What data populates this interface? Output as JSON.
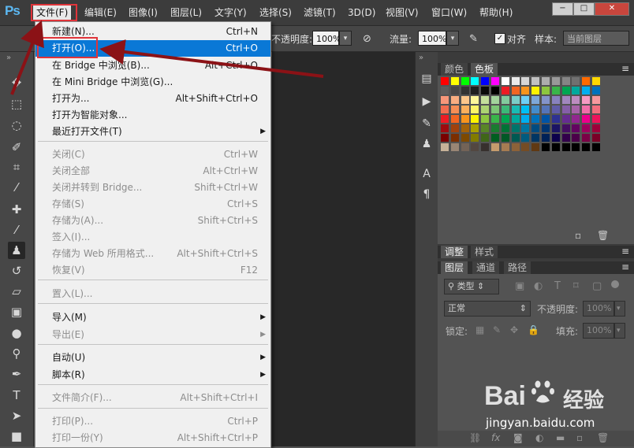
{
  "app": {
    "logo_text": "Ps"
  },
  "menubar": {
    "items": [
      "文件(F)",
      "编辑(E)",
      "图像(I)",
      "图层(L)",
      "文字(Y)",
      "选择(S)",
      "滤镜(T)",
      "3D(D)",
      "视图(V)",
      "窗口(W)",
      "帮助(H)"
    ],
    "active_index": 0
  },
  "window_controls": {
    "minimize": "−",
    "maximize": "□",
    "close": "✕"
  },
  "optionsbar": {
    "opacity_label": "不透明度:",
    "opacity_value": "100%",
    "flow_label": "流量:",
    "flow_value": "100%",
    "align_label": "对齐",
    "align_checked": "✓",
    "sample_label": "样本:",
    "sample_value": "当前图层",
    "dropdown_glyph": "▾"
  },
  "file_menu": {
    "items": [
      {
        "label": "新建(N)...",
        "shortcut": "Ctrl+N",
        "disabled": false
      },
      {
        "label": "打开(O)...",
        "shortcut": "Ctrl+O",
        "disabled": false,
        "highlighted": true
      },
      {
        "label": "在 Bridge 中浏览(B)...",
        "shortcut": "Alt+Ctrl+O",
        "disabled": false
      },
      {
        "label": "在 Mini Bridge 中浏览(G)...",
        "shortcut": "",
        "disabled": false
      },
      {
        "label": "打开为...",
        "shortcut": "Alt+Shift+Ctrl+O",
        "disabled": false
      },
      {
        "label": "打开为智能对象...",
        "shortcut": "",
        "disabled": false
      },
      {
        "label": "最近打开文件(T)",
        "shortcut": "",
        "disabled": false,
        "submenu": true
      },
      {
        "label": "关闭(C)",
        "shortcut": "Ctrl+W",
        "disabled": true
      },
      {
        "label": "关闭全部",
        "shortcut": "Alt+Ctrl+W",
        "disabled": true
      },
      {
        "label": "关闭并转到 Bridge...",
        "shortcut": "Shift+Ctrl+W",
        "disabled": true
      },
      {
        "label": "存储(S)",
        "shortcut": "Ctrl+S",
        "disabled": true
      },
      {
        "label": "存储为(A)...",
        "shortcut": "Shift+Ctrl+S",
        "disabled": true
      },
      {
        "label": "签入(I)...",
        "shortcut": "",
        "disabled": true
      },
      {
        "label": "存储为 Web 所用格式...",
        "shortcut": "Alt+Shift+Ctrl+S",
        "disabled": true
      },
      {
        "label": "恢复(V)",
        "shortcut": "F12",
        "disabled": true
      },
      {
        "label": "置入(L)...",
        "shortcut": "",
        "disabled": true
      },
      {
        "label": "导入(M)",
        "shortcut": "",
        "disabled": false,
        "submenu": true
      },
      {
        "label": "导出(E)",
        "shortcut": "",
        "disabled": true,
        "submenu": true
      },
      {
        "label": "自动(U)",
        "shortcut": "",
        "disabled": false,
        "submenu": true
      },
      {
        "label": "脚本(R)",
        "shortcut": "",
        "disabled": false,
        "submenu": true
      },
      {
        "label": "文件简介(F)...",
        "shortcut": "Alt+Shift+Ctrl+I",
        "disabled": true
      },
      {
        "label": "打印(P)...",
        "shortcut": "Ctrl+P",
        "disabled": true
      },
      {
        "label": "打印一份(Y)",
        "shortcut": "Alt+Shift+Ctrl+P",
        "disabled": true
      }
    ],
    "submenu_glyph": "▶"
  },
  "panels": {
    "swatches_tabs": [
      "颜色",
      "色板"
    ],
    "swatches_active": 1,
    "adjust_tabs": [
      "调整",
      "样式"
    ],
    "layers_tabs": [
      "图层",
      "通道",
      "路径"
    ],
    "filter_label": "类型",
    "blend_mode": "正常",
    "opacity_label": "不透明度:",
    "opacity_value": "100%",
    "lock_label": "锁定:",
    "fill_label": "填充:",
    "fill_value": "100%",
    "menu_glyph": "≡",
    "collapse_glyph": "»"
  },
  "swatches": {
    "rows": [
      [
        "#ff0000",
        "#ffff00",
        "#00ff00",
        "#00ffff",
        "#0000ff",
        "#ff00ff",
        "#ffffff",
        "#ebebeb",
        "#d6d6d6",
        "#c2c2c2",
        "#adadad",
        "#999999",
        "#858585",
        "#707070",
        "#ff6a00",
        "#ffd800"
      ],
      [
        "#5c5c5c",
        "#474747",
        "#333333",
        "#1f1f1f",
        "#0a0a0a",
        "#000000",
        "#ed1c24",
        "#f26522",
        "#f7941d",
        "#fff200",
        "#8dc63f",
        "#39b54a",
        "#00a651",
        "#00a99d",
        "#00aeef",
        "#0072bc"
      ],
      [
        "#f7977a",
        "#f9ad81",
        "#fdc68a",
        "#fff79a",
        "#c4df9b",
        "#a2d39c",
        "#82ca9d",
        "#7bcdc8",
        "#6ecff6",
        "#7ea7d8",
        "#8493ca",
        "#8882be",
        "#a187be",
        "#bc8cbf",
        "#f49ac2",
        "#f6989d"
      ],
      [
        "#f26c4f",
        "#f68e55",
        "#fbaf5c",
        "#fff467",
        "#acd372",
        "#7cc576",
        "#3bb878",
        "#1abbb4",
        "#00bff3",
        "#438ccb",
        "#5574b9",
        "#605ca8",
        "#855fa8",
        "#a763a8",
        "#f06ea9",
        "#f26d7d"
      ],
      [
        "#ed1c24",
        "#f26522",
        "#f7941d",
        "#fff200",
        "#8dc63f",
        "#39b54a",
        "#00a651",
        "#00a99d",
        "#00aeef",
        "#0072bc",
        "#0054a6",
        "#2e3192",
        "#662d91",
        "#92278f",
        "#ec008c",
        "#ed145b"
      ],
      [
        "#9e0b0f",
        "#a0410d",
        "#a36209",
        "#aba000",
        "#598527",
        "#1a7b30",
        "#007236",
        "#00746b",
        "#0076a3",
        "#004b80",
        "#003471",
        "#1b1464",
        "#440e62",
        "#630460",
        "#9e005d",
        "#9e0039"
      ],
      [
        "#790000",
        "#7b2e00",
        "#7d4900",
        "#827b00",
        "#406618",
        "#005e20",
        "#005826",
        "#005952",
        "#005b7f",
        "#003663",
        "#002157",
        "#0d004c",
        "#32004b",
        "#4b0049",
        "#7b0046",
        "#7a0026"
      ],
      [
        "#c7b299",
        "#998675",
        "#736357",
        "#534741",
        "#37302d",
        "#c69c6d",
        "#a67c52",
        "#8c6239",
        "#754c24",
        "#603913",
        "#000000",
        "#000000",
        "#000000",
        "#000000",
        "#000000",
        "#000000"
      ]
    ]
  },
  "watermark": {
    "brand": "Bai",
    "brand2": "经验",
    "url": "jingyan.baidu.com"
  }
}
